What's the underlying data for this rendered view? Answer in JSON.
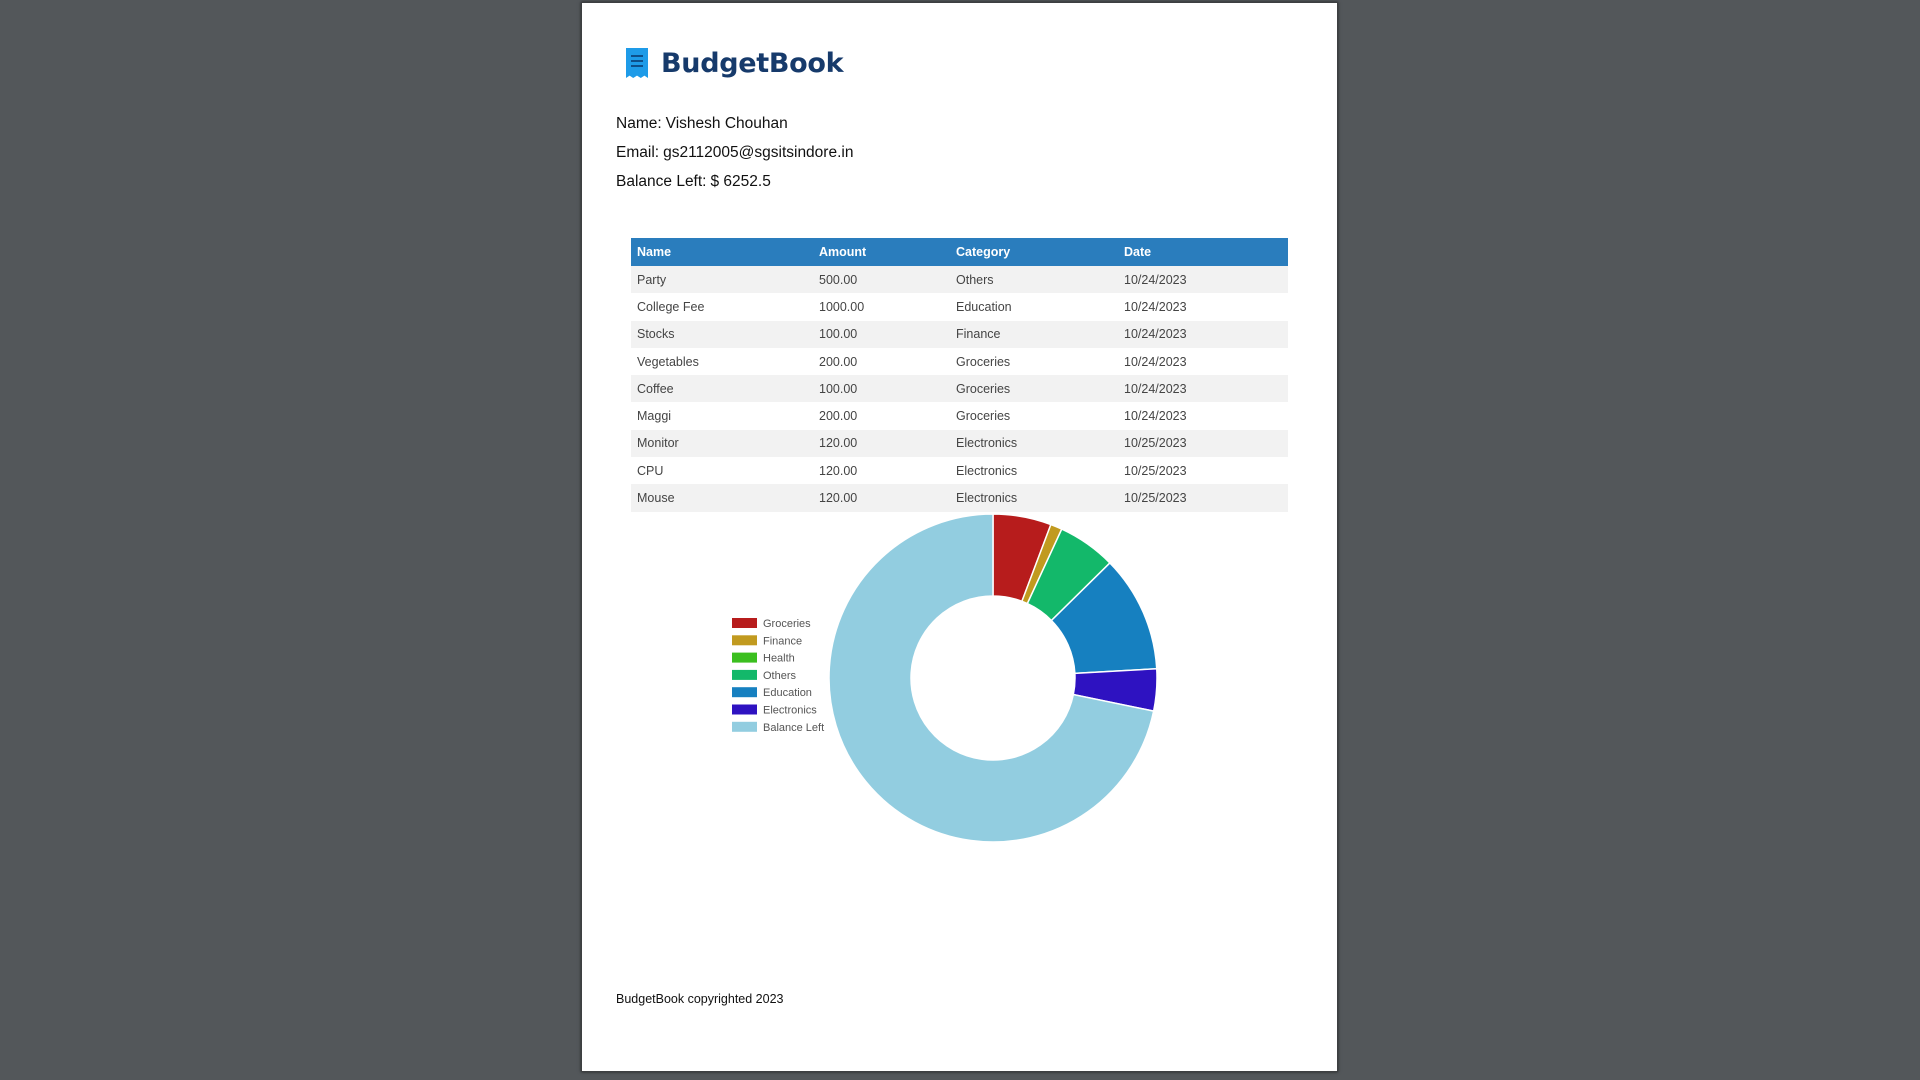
{
  "brand": {
    "name": "BudgetBook"
  },
  "user": {
    "name_label": "Name:",
    "name": "Vishesh Chouhan",
    "email_label": "Email:",
    "email": "gs2112005@sgsitsindore.in",
    "balance_label": "Balance Left:",
    "balance": "$ 6252.5"
  },
  "table": {
    "headers": [
      "Name",
      "Amount",
      "Category",
      "Date"
    ],
    "rows": [
      [
        "Party",
        "500.00",
        "Others",
        "10/24/2023"
      ],
      [
        "College Fee",
        "1000.00",
        "Education",
        "10/24/2023"
      ],
      [
        "Stocks",
        "100.00",
        "Finance",
        "10/24/2023"
      ],
      [
        "Vegetables",
        "200.00",
        "Groceries",
        "10/24/2023"
      ],
      [
        "Coffee",
        "100.00",
        "Groceries",
        "10/24/2023"
      ],
      [
        "Maggi",
        "200.00",
        "Groceries",
        "10/24/2023"
      ],
      [
        "Monitor",
        "120.00",
        "Electronics",
        "10/25/2023"
      ],
      [
        "CPU",
        "120.00",
        "Electronics",
        "10/25/2023"
      ],
      [
        "Mouse",
        "120.00",
        "Electronics",
        "10/25/2023"
      ]
    ]
  },
  "chart_data": {
    "type": "pie",
    "title": "",
    "labels": [
      "Groceries",
      "Finance",
      "Health",
      "Others",
      "Education",
      "Electronics",
      "Balance Left"
    ],
    "values": [
      500,
      100,
      0,
      500,
      1000,
      360,
      6252.5
    ],
    "colors": [
      "#b71c1c",
      "#c19a1f",
      "#3bbf1f",
      "#13b86a",
      "#1680c0",
      "#2e12c1",
      "#92cde0"
    ],
    "legend_position": "left",
    "donut": true
  },
  "footer": {
    "text": "BudgetBook copyrighted 2023"
  }
}
